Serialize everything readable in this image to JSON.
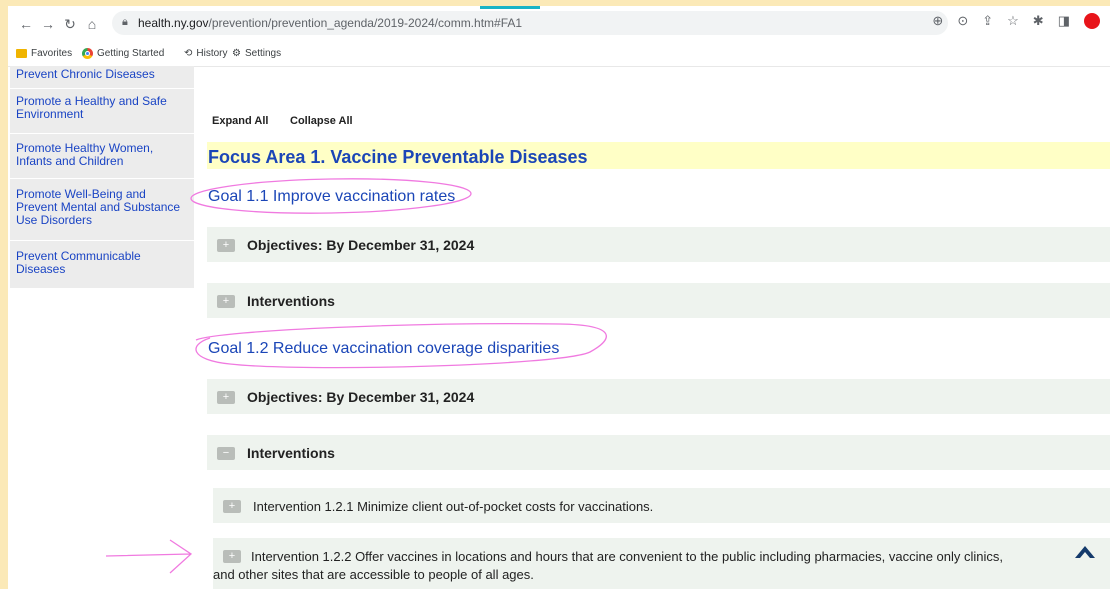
{
  "browser": {
    "url_host": "health.ny.gov",
    "url_path": "/prevention/prevention_agenda/2019-2024/comm.htm#FA1",
    "bookmarks": [
      "Favorites",
      "Getting Started",
      "History",
      "Settings"
    ]
  },
  "sidebar": {
    "items": [
      "Prevent Chronic Diseases",
      "Promote a Healthy and Safe Environment",
      "Promote Healthy Women, Infants and Children",
      "Promote Well-Being and Prevent Mental and Substance Use Disorders",
      "Prevent Communicable Diseases"
    ]
  },
  "controls": {
    "expand_all": "Expand All",
    "collapse_all": "Collapse All"
  },
  "focus_area": {
    "title": "Focus Area 1. Vaccine Preventable Diseases"
  },
  "goals": [
    {
      "title": "Goal 1.1 Improve vaccination rates",
      "objectives": "Objectives: By December 31, 2024",
      "interventions": "Interventions"
    },
    {
      "title": "Goal 1.2 Reduce vaccination coverage disparities",
      "objectives": "Objectives: By December 31, 2024",
      "interventions": "Interventions",
      "intervention_items": [
        "Intervention 1.2.1 Minimize client out-of-pocket costs for vaccinations.",
        "Intervention 1.2.2 Offer vaccines in locations and hours that are convenient to the public including pharmacies, vaccine only clinics,",
        "and other sites that are accessible to people of all ages."
      ]
    }
  ],
  "colors": {
    "link_blue": "#1b46b7",
    "annotation_pink": "#f07ae0",
    "focus_bg": "#ffffc6",
    "accordion_bg": "#eef3ee",
    "frame": "#fbe9b7"
  }
}
